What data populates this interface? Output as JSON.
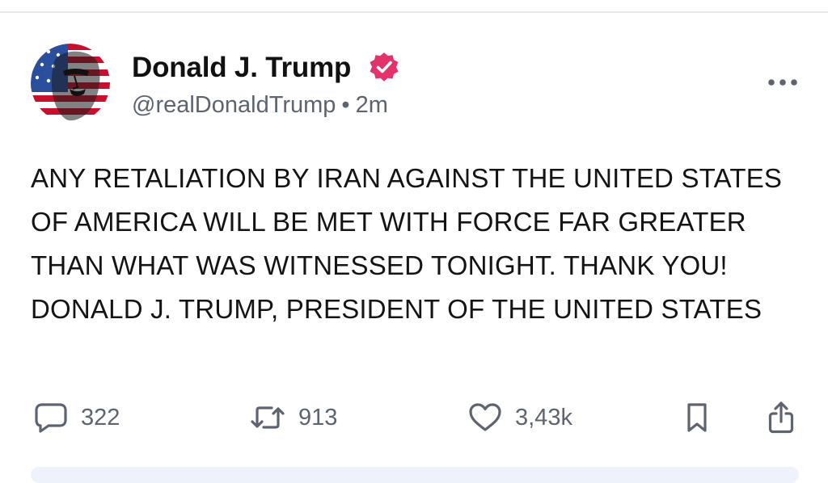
{
  "post": {
    "author": {
      "display_name": "Donald J. Trump",
      "handle": "@realDonaldTrump",
      "separator": "•",
      "time": "2m",
      "verified_color": "#e3336a",
      "avatar_icon": "avatar-image"
    },
    "text": "ANY RETALIATION BY IRAN AGAINST THE UNITED STATES OF AMERICA WILL BE MET WITH FORCE FAR GREATER THAN WHAT WAS WITNESSED TONIGHT. THANK YOU! DONALD J. TRUMP, PRESIDENT OF THE UNITED STATES",
    "actions": {
      "replies": "322",
      "reposts": "913",
      "likes": "3,43k",
      "reply_icon": "speech-bubble-icon",
      "repost_icon": "repost-icon",
      "like_icon": "heart-icon",
      "bookmark_icon": "bookmark-icon",
      "share_icon": "share-icon"
    },
    "more_icon": "ellipsis-icon"
  },
  "colors": {
    "text": "#141414",
    "secondary": "#5d6470",
    "divider": "#e6e7ea"
  }
}
